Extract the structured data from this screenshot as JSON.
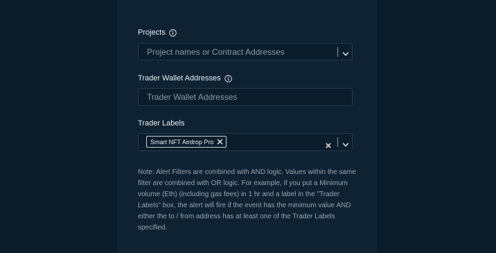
{
  "projects": {
    "label": "Projects",
    "placeholder": "Project names or Contract Addresses"
  },
  "trader_wallets": {
    "label": "Trader Wallet Addresses",
    "placeholder": "Trader Wallet Addresses"
  },
  "trader_labels": {
    "label": "Trader Labels",
    "selected_chips": [
      "Smart NFT Airdrop Pro"
    ]
  },
  "note": {
    "text": "Note: Alert Filters are combined with AND logic. Values within the same filter are combined with OR logic. For example, if you put a Minimum volume (Eth) (including gas fees) in 1 hr and a label in the \"Trader Labels\" box, the alert will fire if the event has the minimum value AND either the to / from address has at least one of the Trader Labels specified."
  },
  "icons": {
    "info": "info-circle-icon",
    "dropdown": "chevron-down-icon",
    "remove_chip": "x-icon",
    "clear": "x-icon"
  },
  "colors": {
    "page_background": "#0b1b28",
    "panel_background": "#0e2232",
    "field_background": "#0b1d2b",
    "field_border": "#24394a",
    "text_primary": "#e8eef3",
    "text_muted": "#8a99a5"
  }
}
